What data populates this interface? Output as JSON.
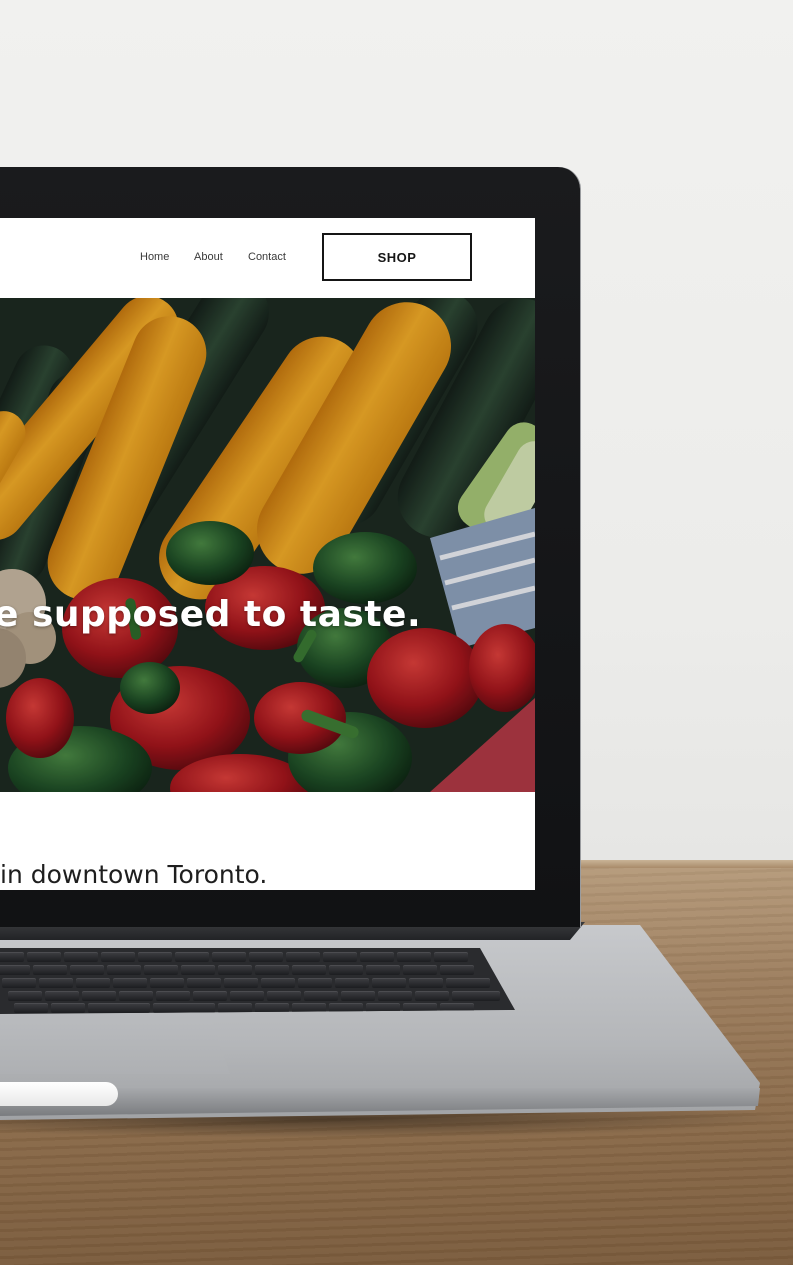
{
  "nav": {
    "links": [
      "Home",
      "About",
      "Contact"
    ],
    "shop_label": "SHOP"
  },
  "hero": {
    "tagline": "e supposed to taste."
  },
  "intro": {
    "text": "in downtown Toronto."
  },
  "colors": {
    "button_border": "#151515",
    "page_background": "#ffffff",
    "zucchini_yellow": "#f0a01e",
    "pepper_red": "#b51c22",
    "pepper_green": "#1f5a2a"
  }
}
